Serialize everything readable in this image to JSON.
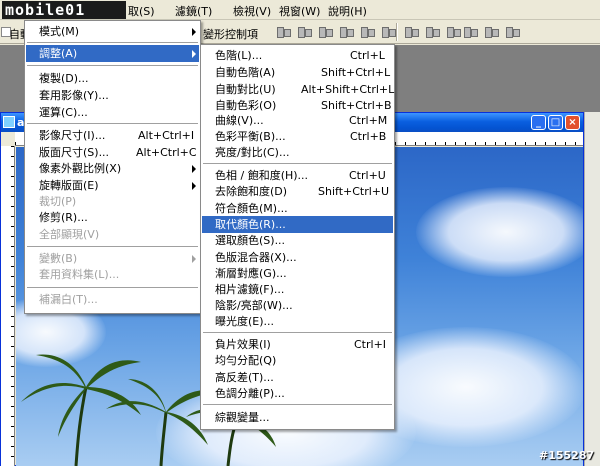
{
  "app": {
    "logo_text": "mobile01",
    "menubar": [
      "取(S)",
      "濾鏡(T)",
      "檢視(V)",
      "視窗(W)",
      "說明(H)"
    ]
  },
  "optbar": {
    "left_label": "自動",
    "transform_label": "變形控制項"
  },
  "document": {
    "title": "a_"
  },
  "main_menu": {
    "items": [
      {
        "label": "模式(M)",
        "submenu": true,
        "disabled": false
      },
      {
        "label": "調整(A)",
        "submenu": true,
        "disabled": false,
        "highlighted": true
      },
      {
        "label": "複製(D)...",
        "disabled": false
      },
      {
        "label": "套用影像(Y)...",
        "disabled": false
      },
      {
        "label": "運算(C)...",
        "disabled": false
      },
      {
        "label": "影像尺寸(I)...",
        "shortcut": "Alt+Ctrl+I",
        "disabled": false
      },
      {
        "label": "版面尺寸(S)...",
        "shortcut": "Alt+Ctrl+C",
        "disabled": false
      },
      {
        "label": "像素外觀比例(X)",
        "submenu": true,
        "disabled": false
      },
      {
        "label": "旋轉版面(E)",
        "submenu": true,
        "disabled": false
      },
      {
        "label": "裁切(P)",
        "disabled": true
      },
      {
        "label": "修剪(R)...",
        "disabled": false
      },
      {
        "label": "全部顯現(V)",
        "disabled": true
      },
      {
        "label": "變數(B)",
        "submenu": true,
        "disabled": true
      },
      {
        "label": "套用資料集(L)...",
        "disabled": true
      },
      {
        "label": "補漏白(T)...",
        "disabled": true
      }
    ]
  },
  "adjust_menu": {
    "items": [
      {
        "label": "色階(L)...",
        "shortcut": "Ctrl+L"
      },
      {
        "label": "自動色階(A)",
        "shortcut": "Shift+Ctrl+L"
      },
      {
        "label": "自動對比(U)",
        "shortcut": "Alt+Shift+Ctrl+L"
      },
      {
        "label": "自動色彩(O)",
        "shortcut": "Shift+Ctrl+B"
      },
      {
        "label": "曲線(V)...",
        "shortcut": "Ctrl+M"
      },
      {
        "label": "色彩平衡(B)...",
        "shortcut": "Ctrl+B"
      },
      {
        "label": "亮度/對比(C)..."
      },
      {
        "label": "色相 / 飽和度(H)...",
        "shortcut": "Ctrl+U"
      },
      {
        "label": "去除飽和度(D)",
        "shortcut": "Shift+Ctrl+U"
      },
      {
        "label": "符合顏色(M)..."
      },
      {
        "label": "取代顏色(R)...",
        "highlighted": true
      },
      {
        "label": "選取顏色(S)..."
      },
      {
        "label": "色版混合器(X)..."
      },
      {
        "label": "漸層對應(G)..."
      },
      {
        "label": "相片濾鏡(F)..."
      },
      {
        "label": "陰影/亮部(W)..."
      },
      {
        "label": "曝光度(E)..."
      },
      {
        "label": "負片效果(I)",
        "shortcut": "Ctrl+I"
      },
      {
        "label": "均勻分配(Q)"
      },
      {
        "label": "高反差(T)..."
      },
      {
        "label": "色調分離(P)..."
      },
      {
        "label": "綜觀變量..."
      }
    ]
  },
  "watermark": "#155287"
}
